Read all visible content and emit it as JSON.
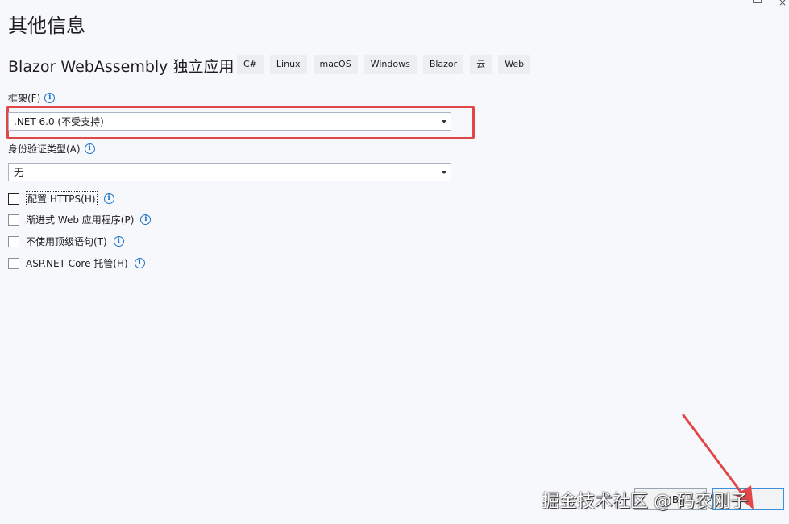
{
  "page": {
    "title": "其他信息"
  },
  "template": {
    "name": "Blazor WebAssembly 独立应用",
    "tags": [
      "C#",
      "Linux",
      "macOS",
      "Windows",
      "Blazor",
      "云",
      "Web"
    ]
  },
  "framework": {
    "label": "框架(F)",
    "value": ".NET 6.0 (不受支持)"
  },
  "auth": {
    "label": "身份验证类型(A)",
    "value": "无"
  },
  "options": [
    {
      "label": "配置 HTTPS(H)",
      "checked": false
    },
    {
      "label": "渐进式 Web 应用程序(P)",
      "checked": false
    },
    {
      "label": "不使用顶级语句(T)",
      "checked": false
    },
    {
      "label": "ASP.NET Core 托管(H)",
      "checked": false
    }
  ],
  "buttons": {
    "secondary_partial": "一(B)",
    "primary_partial": "C"
  },
  "watermark": "掘金技术社区 @ 码农刚子",
  "icons": {
    "info": "info-icon",
    "dropdown": "chevron-down-icon",
    "annotation": "red-arrow"
  },
  "colors": {
    "highlight": "#e04848",
    "accent": "#1a73c8"
  }
}
